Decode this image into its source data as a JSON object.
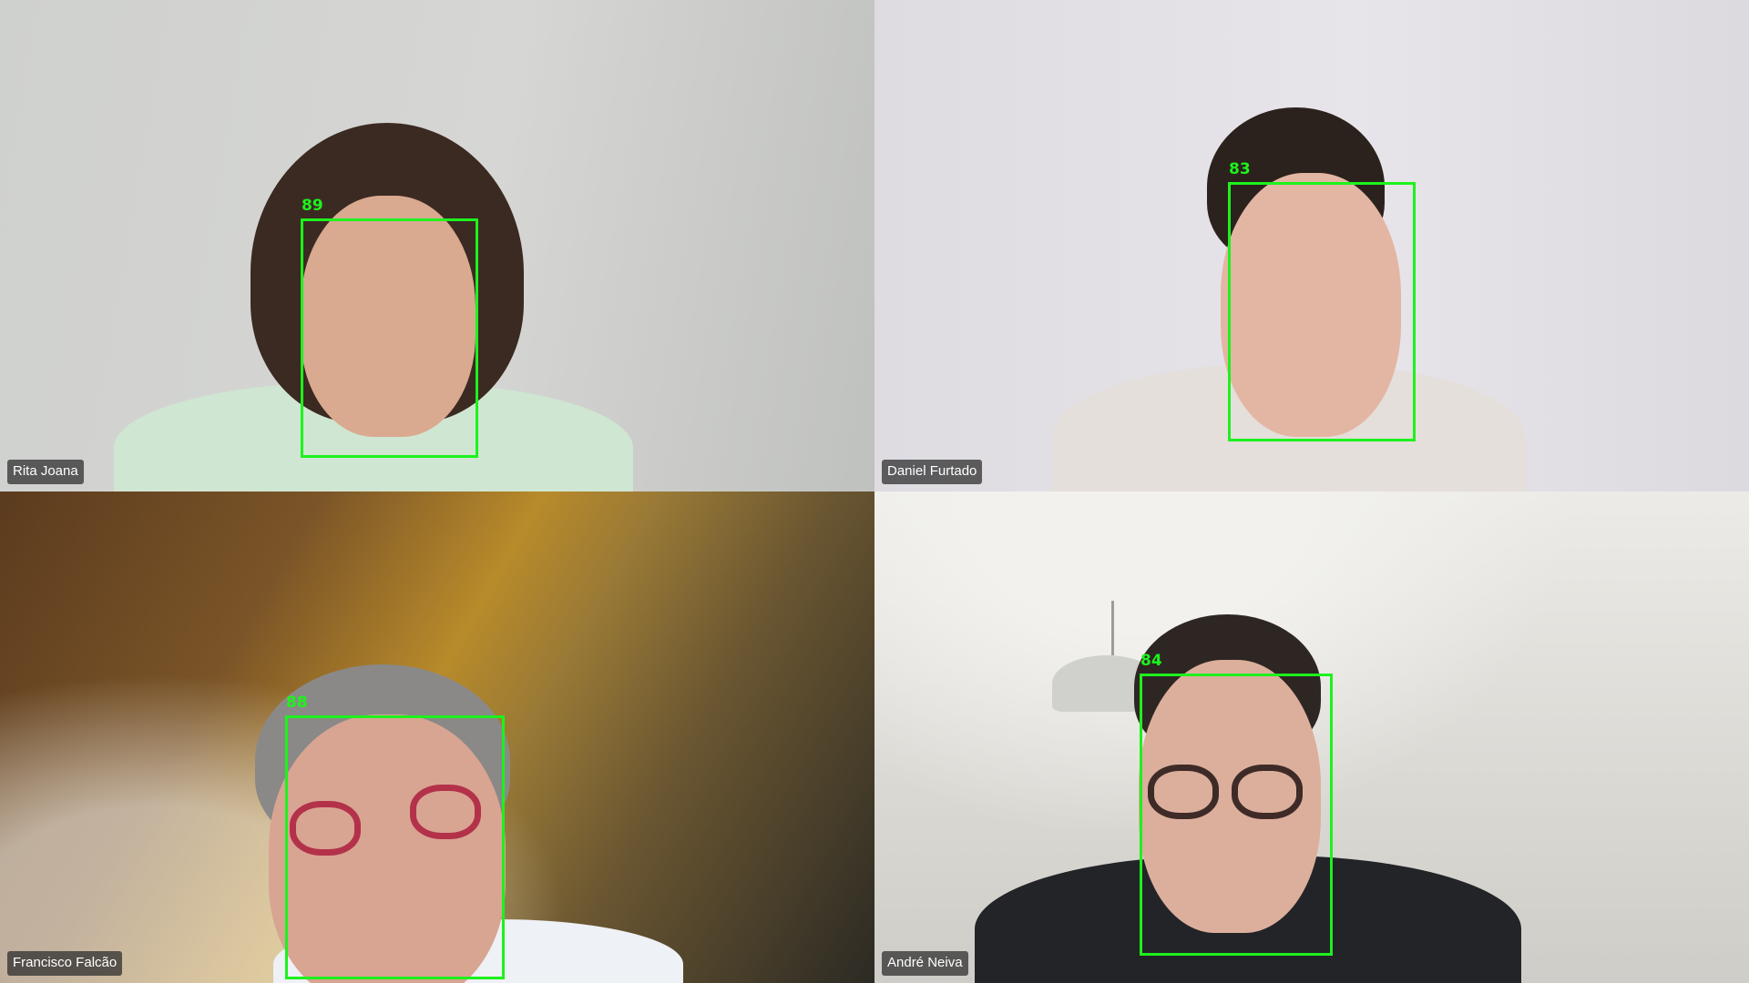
{
  "participants": [
    {
      "name": "Rita Joana",
      "detection_score": "89"
    },
    {
      "name": "Daniel Furtado",
      "detection_score": "83"
    },
    {
      "name": "Francisco Falcão",
      "detection_score": "88"
    },
    {
      "name": "André Neiva",
      "detection_score": "84"
    }
  ],
  "colors": {
    "detection_box": "#1df21d",
    "name_tag_bg": "rgba(40,40,40,0.72)",
    "name_tag_text": "#ffffff"
  }
}
